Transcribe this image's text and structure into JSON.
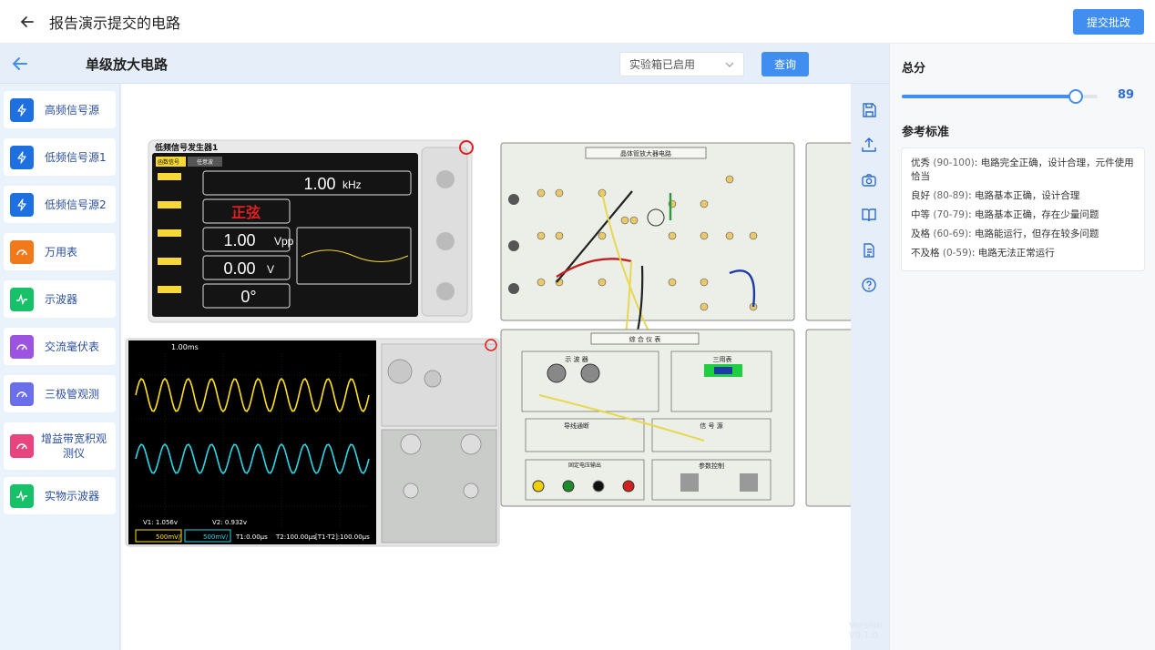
{
  "header": {
    "title": "报告演示提交的电路",
    "submit_label": "提交批改"
  },
  "circuit": {
    "title": "单级放大电路",
    "status_select": "实验箱已启用",
    "query_label": "查询"
  },
  "sidebar": {
    "items": [
      {
        "label": "高频信号源",
        "icon": "bolt-icon",
        "color": "#1e6fe0"
      },
      {
        "label": "低频信号源1",
        "icon": "bolt-icon",
        "color": "#1e6fe0"
      },
      {
        "label": "低频信号源2",
        "icon": "bolt-icon",
        "color": "#1e6fe0"
      },
      {
        "label": "万用表",
        "icon": "gauge-icon",
        "color": "#f07a1a"
      },
      {
        "label": "示波器",
        "icon": "pulse-icon",
        "color": "#18c06a"
      },
      {
        "label": "交流毫伏表",
        "icon": "gauge-icon",
        "color": "#9c54e0"
      },
      {
        "label": "三极管观测",
        "icon": "gauge-icon",
        "color": "#6a6ee8"
      },
      {
        "label": "增益带宽积观测仪",
        "label_l1": "增益带宽积观",
        "label_l2": "测仪",
        "icon": "gauge-icon",
        "color": "#e8457e"
      },
      {
        "label": "实物示波器",
        "icon": "pulse-icon",
        "color": "#18c06a"
      }
    ]
  },
  "toolbar": [
    "save-icon",
    "upload-icon",
    "camera-icon",
    "book-icon",
    "document-icon",
    "help-icon"
  ],
  "instruments": {
    "generator": {
      "title": "低频信号发生器1",
      "tab1": "函数信号",
      "tab2": "任意波",
      "freq_value": "1.00",
      "freq_unit": "kHz",
      "waveform": "正弦",
      "amp_value": "1.00",
      "amp_unit": "Vpp",
      "offset_value": "0.00",
      "offset_unit": "V",
      "phase_value": "0°"
    },
    "oscilloscope": {
      "timebase": "1.00ms",
      "v1": "V1: 1.056v",
      "v2": "V2: 0.932v",
      "ch1": "500mV/",
      "ch2": "500mV/",
      "t1": "T1:0.00μs",
      "t2": "T2:100.00μs",
      "dt": "[T1-T2]:100.00μs"
    },
    "board1_title": "晶体管放大器电路",
    "board2_title": "综 合 仪 表",
    "board2_sub": {
      "osc": "示 波 器",
      "meter": "三用表",
      "cont": "导线通断",
      "sig": "信 号 源",
      "dc": "固定电压输出",
      "param": "参数控制"
    }
  },
  "version": "Version: V0.1.0",
  "grading": {
    "total_label": "总分",
    "score": "89",
    "score_fraction": 0.89,
    "criteria_label": "参考标准",
    "criteria": [
      {
        "level": "优秀",
        "range": "(90-100)",
        "desc": ": 电路完全正确，设计合理，元件使用恰当"
      },
      {
        "level": "良好",
        "range": "(80-89)",
        "desc": ": 电路基本正确，设计合理"
      },
      {
        "level": "中等",
        "range": "(70-79)",
        "desc": ": 电路基本正确，存在少量问题"
      },
      {
        "level": "及格",
        "range": "(60-69)",
        "desc": ": 电路能运行，但存在较多问题"
      },
      {
        "level": "不及格",
        "range": "(0-59)",
        "desc": ": 电路无法正常运行"
      }
    ]
  }
}
